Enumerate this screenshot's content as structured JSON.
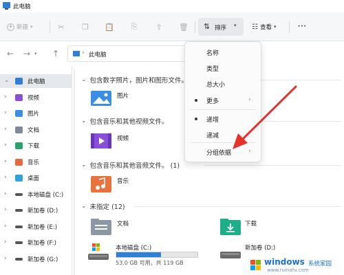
{
  "window": {
    "title": "此电脑"
  },
  "toolbar": {
    "new_label": "新建",
    "sort_label": "排序",
    "view_label": "查看",
    "more_label": "···",
    "icons": [
      "cut-icon",
      "copy-icon",
      "paste-icon",
      "rename-icon",
      "share-icon",
      "delete-icon"
    ]
  },
  "address": {
    "path": "此电脑"
  },
  "nav": {
    "back": "←",
    "forward": "→",
    "up": "↑"
  },
  "sidebar": {
    "items": [
      {
        "label": "此电脑",
        "icon": "pc-icon",
        "color": "#2f7fd6"
      },
      {
        "label": "视频",
        "icon": "video-folder-icon",
        "color": "#8a4fd8"
      },
      {
        "label": "图片",
        "icon": "pictures-folder-icon",
        "color": "#3a8ee6"
      },
      {
        "label": "文档",
        "icon": "documents-folder-icon",
        "color": "#7c8a99"
      },
      {
        "label": "下载",
        "icon": "download-icon",
        "color": "#27a36b"
      },
      {
        "label": "音乐",
        "icon": "music-icon",
        "color": "#e56a3b"
      },
      {
        "label": "桌面",
        "icon": "desktop-icon",
        "color": "#2fa3d9"
      },
      {
        "label": "本地磁盘 (C:)",
        "icon": "drive-icon",
        "color": "#555555"
      },
      {
        "label": "新加卷 (D:)",
        "icon": "drive-icon",
        "color": "#555555"
      },
      {
        "label": "新加卷 (E:)",
        "icon": "drive-icon",
        "color": "#555555"
      },
      {
        "label": "新加卷 (F:)",
        "icon": "drive-icon",
        "color": "#555555"
      },
      {
        "label": "新加卷 (G:)",
        "icon": "drive-icon",
        "color": "#555555"
      }
    ]
  },
  "content": {
    "groups": [
      {
        "title": "包含数字照片，图片和图形文件。",
        "items": [
          "图片"
        ]
      },
      {
        "title": "包含音乐和其他视频文件。",
        "items": [
          "视频"
        ]
      },
      {
        "title": "包含音乐和其他音频文件。 (1)",
        "items": [
          "音乐"
        ]
      },
      {
        "title": "未指定 (12)",
        "items": [
          "文档",
          "下载"
        ]
      }
    ],
    "drives": [
      {
        "label": "本地磁盘 (C:)",
        "free_text": "53.0 GB 可用，共 119 GB",
        "used_fraction": 0.55
      },
      {
        "label": "新加卷 (D:)"
      }
    ]
  },
  "sort_menu": {
    "items": [
      {
        "label": "名称"
      },
      {
        "label": "类型"
      },
      {
        "label": "总大小"
      },
      {
        "label": "更多",
        "selected": true,
        "submenu": true
      },
      {
        "label": "递增",
        "selected": true
      },
      {
        "label": "递减"
      },
      {
        "label": "分组依据",
        "submenu": true
      }
    ]
  },
  "watermark": {
    "brand": "windows",
    "brand_suffix": "系统家园",
    "url": "www.ruinafu.com"
  },
  "colors": {
    "accent": "#2f7fd6",
    "arrow": "#e5322d"
  }
}
